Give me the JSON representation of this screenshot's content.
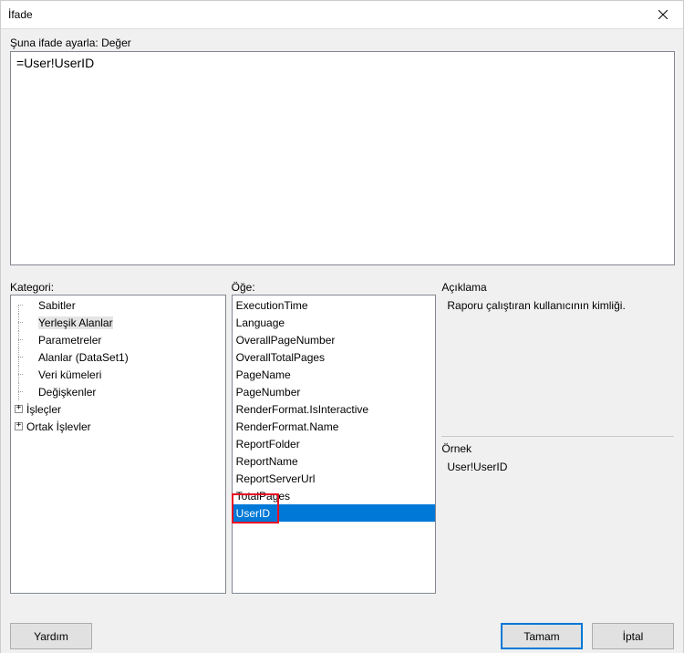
{
  "window": {
    "title": "İfade"
  },
  "expression": {
    "label": "Şuna ifade ayarla: Değer",
    "value": "=User!UserID"
  },
  "category": {
    "label": "Kategori:",
    "items": [
      {
        "label": "Sabitler",
        "expandable": false
      },
      {
        "label": "Yerleşik Alanlar",
        "expandable": false,
        "selected": true
      },
      {
        "label": "Parametreler",
        "expandable": false
      },
      {
        "label": "Alanlar (DataSet1)",
        "expandable": false
      },
      {
        "label": "Veri kümeleri",
        "expandable": false
      },
      {
        "label": "Değişkenler",
        "expandable": false
      },
      {
        "label": "İşleçler",
        "expandable": true
      },
      {
        "label": "Ortak İşlevler",
        "expandable": true
      }
    ]
  },
  "item": {
    "label": "Öğe:",
    "items": [
      "ExecutionTime",
      "Language",
      "OverallPageNumber",
      "OverallTotalPages",
      "PageName",
      "PageNumber",
      "RenderFormat.IsInteractive",
      "RenderFormat.Name",
      "ReportFolder",
      "ReportName",
      "ReportServerUrl",
      "TotalPages",
      "UserID"
    ],
    "selected": "UserID"
  },
  "description": {
    "label": "Açıklama",
    "text": "Raporu çalıştıran kullanıcının kimliği."
  },
  "example": {
    "label": "Örnek",
    "text": "User!UserID"
  },
  "buttons": {
    "help": "Yardım",
    "ok": "Tamam",
    "cancel": "İptal"
  }
}
